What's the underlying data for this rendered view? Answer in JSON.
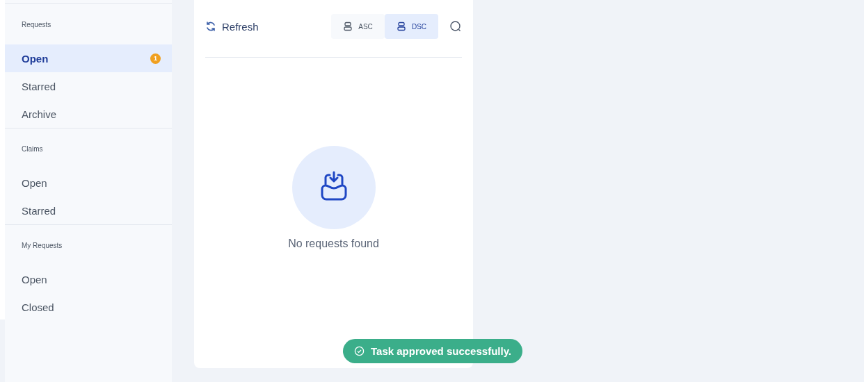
{
  "sidebar": {
    "sections": [
      {
        "title": "Requests",
        "items": [
          {
            "label": "Open",
            "selected": true,
            "badge": "1"
          },
          {
            "label": "Starred",
            "selected": false
          },
          {
            "label": "Archive",
            "selected": false
          }
        ]
      },
      {
        "title": "Claims",
        "items": [
          {
            "label": "Open",
            "selected": false
          },
          {
            "label": "Starred",
            "selected": false
          }
        ]
      },
      {
        "title": "My Requests",
        "items": [
          {
            "label": "Open",
            "selected": false
          },
          {
            "label": "Closed",
            "selected": false
          }
        ]
      }
    ]
  },
  "toolbar": {
    "refresh": "Refresh",
    "sort": [
      {
        "label": "ASC",
        "selected": false
      },
      {
        "label": "DSC",
        "selected": true
      }
    ]
  },
  "empty_state": {
    "message": "No requests found"
  },
  "toast": {
    "message": "Task approved successfully."
  }
}
